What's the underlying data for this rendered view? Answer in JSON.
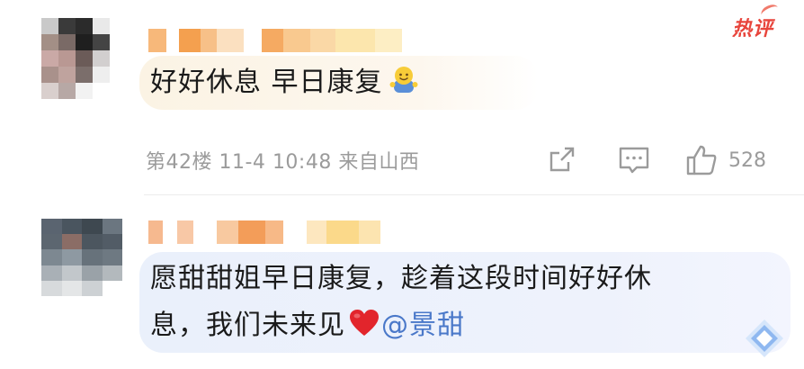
{
  "comments": [
    {
      "text": "好好休息 早日康复",
      "emoji": "smiley-emoji",
      "floor": "第42楼",
      "date": "11-4",
      "time": "10:48",
      "location": "来自山西",
      "likes": "528",
      "badge": "热评"
    },
    {
      "text_line1": "愿甜甜姐早日康复，趁着这段时间好好休",
      "text_line2": "息，我们未来见",
      "mention": "@景甜",
      "emoji": "red-heart"
    }
  ],
  "colors": {
    "hot_badge": "#e8453c",
    "mention": "#4a78c9",
    "meta": "#9b9b9b",
    "bubble1": "#fbf3e4",
    "bubble2": "#eaf0fb"
  },
  "icons": [
    "share-icon",
    "comment-icon",
    "thumbs-up-icon",
    "diamond-sticker-icon"
  ]
}
